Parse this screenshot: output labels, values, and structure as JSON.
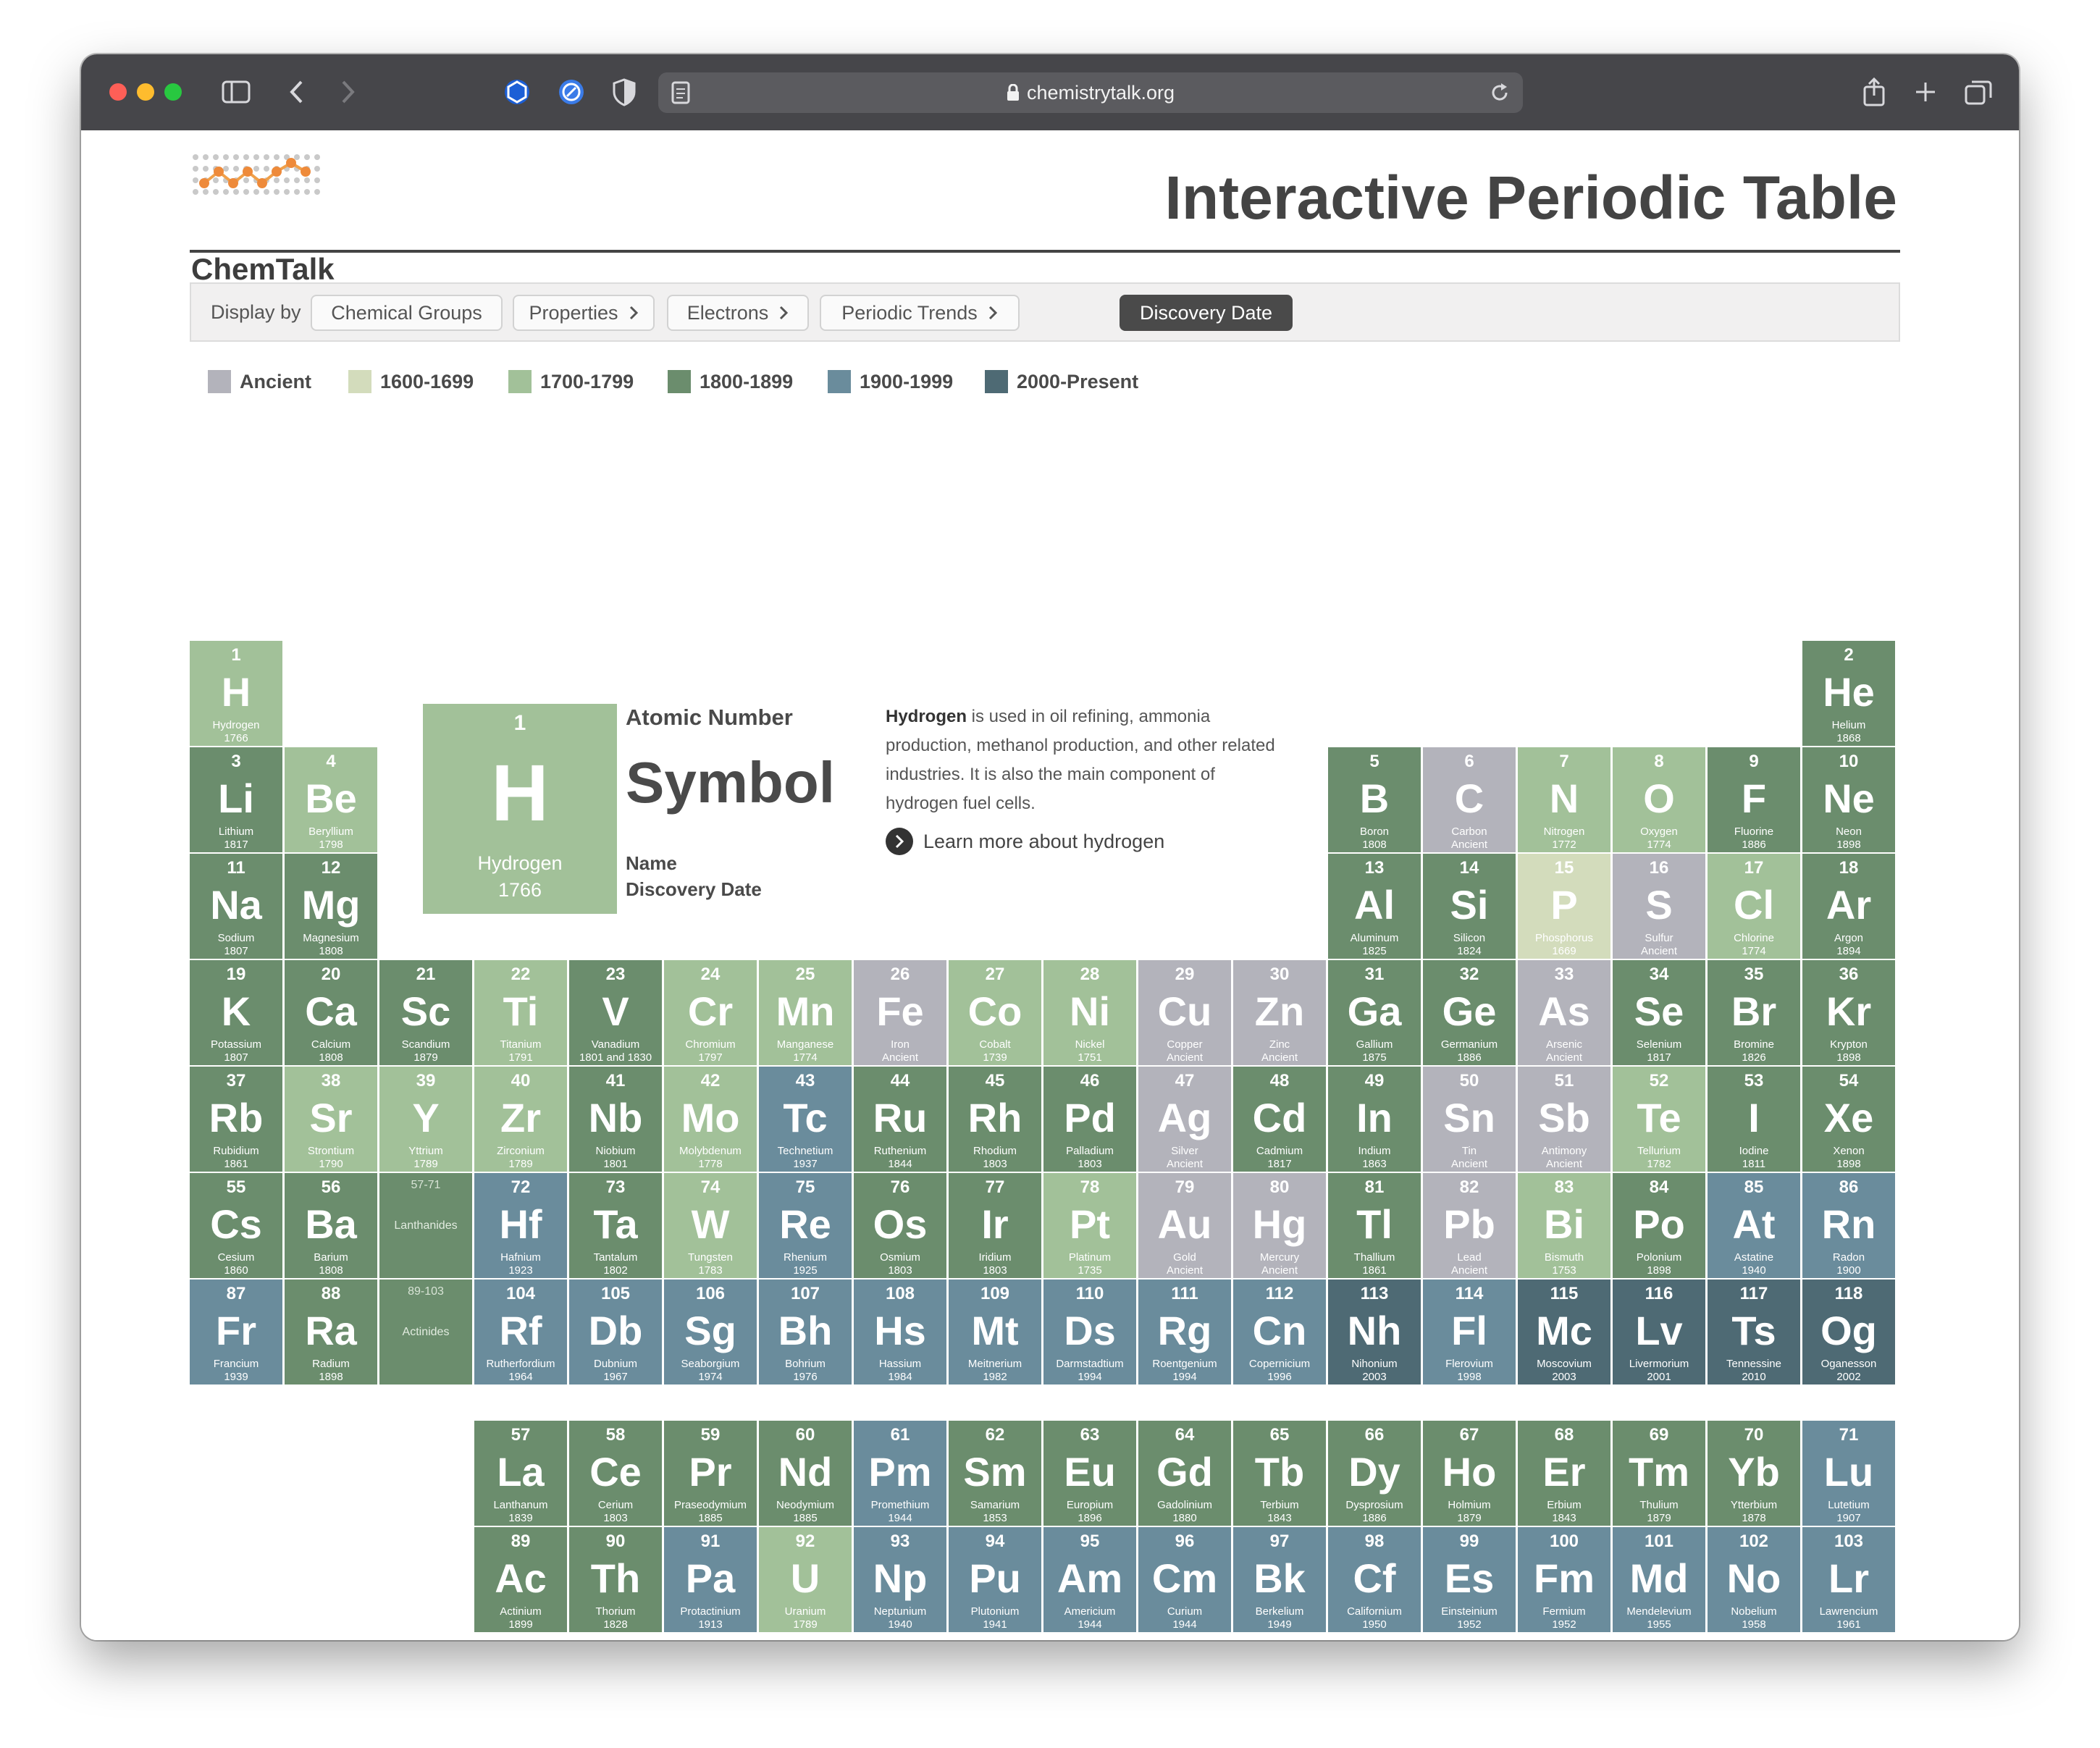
{
  "browser": {
    "url": "chemistrytalk.org"
  },
  "header": {
    "logo_text": "ChemTalk",
    "title": "Interactive Periodic Table"
  },
  "display": {
    "label": "Display by",
    "buttons": [
      {
        "label": "Chemical Groups",
        "chevron": false,
        "active": false
      },
      {
        "label": "Properties",
        "chevron": true,
        "active": false
      },
      {
        "label": "Electrons",
        "chevron": true,
        "active": false
      },
      {
        "label": "Periodic Trends",
        "chevron": true,
        "active": false
      },
      {
        "label": "Discovery Date",
        "chevron": false,
        "active": true
      }
    ]
  },
  "legend": [
    {
      "label": "Ancient",
      "color": "#b3b3bb"
    },
    {
      "label": "1600-1699",
      "color": "#d3dcbc"
    },
    {
      "label": "1700-1799",
      "color": "#a2c199"
    },
    {
      "label": "1800-1899",
      "color": "#6b8d6d"
    },
    {
      "label": "1900-1999",
      "color": "#6a8c9c"
    },
    {
      "label": "2000-Present",
      "color": "#4e6a74"
    }
  ],
  "key": {
    "number": "1",
    "symbol": "H",
    "name": "Hydrogen",
    "date": "1766",
    "label_atomic_number": "Atomic Number",
    "label_symbol": "Symbol",
    "label_name": "Name",
    "label_date": "Discovery Date",
    "desc_element": "Hydrogen",
    "desc_text": " is used in oil refining, ammonia production, methanol production, and other related industries. It is also the main component of hydrogen fuel cells.",
    "learn_more": "Learn more about hydrogen"
  },
  "placeholders": [
    {
      "range": "57-71",
      "label": "Lanthanides"
    },
    {
      "range": "89-103",
      "label": "Actinides"
    }
  ],
  "elements": [
    [
      "1",
      "H",
      "Hydrogen",
      "1766"
    ],
    [
      "2",
      "He",
      "Helium",
      "1868"
    ],
    [
      "3",
      "Li",
      "Lithium",
      "1817"
    ],
    [
      "4",
      "Be",
      "Beryllium",
      "1798"
    ],
    [
      "5",
      "B",
      "Boron",
      "1808"
    ],
    [
      "6",
      "C",
      "Carbon",
      "Ancient"
    ],
    [
      "7",
      "N",
      "Nitrogen",
      "1772"
    ],
    [
      "8",
      "O",
      "Oxygen",
      "1774"
    ],
    [
      "9",
      "F",
      "Fluorine",
      "1886"
    ],
    [
      "10",
      "Ne",
      "Neon",
      "1898"
    ],
    [
      "11",
      "Na",
      "Sodium",
      "1807"
    ],
    [
      "12",
      "Mg",
      "Magnesium",
      "1808"
    ],
    [
      "13",
      "Al",
      "Aluminum",
      "1825"
    ],
    [
      "14",
      "Si",
      "Silicon",
      "1824"
    ],
    [
      "15",
      "P",
      "Phosphorus",
      "1669"
    ],
    [
      "16",
      "S",
      "Sulfur",
      "Ancient"
    ],
    [
      "17",
      "Cl",
      "Chlorine",
      "1774"
    ],
    [
      "18",
      "Ar",
      "Argon",
      "1894"
    ],
    [
      "19",
      "K",
      "Potassium",
      "1807"
    ],
    [
      "20",
      "Ca",
      "Calcium",
      "1808"
    ],
    [
      "21",
      "Sc",
      "Scandium",
      "1879"
    ],
    [
      "22",
      "Ti",
      "Titanium",
      "1791"
    ],
    [
      "23",
      "V",
      "Vanadium",
      "1801 and 1830"
    ],
    [
      "24",
      "Cr",
      "Chromium",
      "1797"
    ],
    [
      "25",
      "Mn",
      "Manganese",
      "1774"
    ],
    [
      "26",
      "Fe",
      "Iron",
      "Ancient"
    ],
    [
      "27",
      "Co",
      "Cobalt",
      "1739"
    ],
    [
      "28",
      "Ni",
      "Nickel",
      "1751"
    ],
    [
      "29",
      "Cu",
      "Copper",
      "Ancient"
    ],
    [
      "30",
      "Zn",
      "Zinc",
      "Ancient"
    ],
    [
      "31",
      "Ga",
      "Gallium",
      "1875"
    ],
    [
      "32",
      "Ge",
      "Germanium",
      "1886"
    ],
    [
      "33",
      "As",
      "Arsenic",
      "Ancient"
    ],
    [
      "34",
      "Se",
      "Selenium",
      "1817"
    ],
    [
      "35",
      "Br",
      "Bromine",
      "1826"
    ],
    [
      "36",
      "Kr",
      "Krypton",
      "1898"
    ],
    [
      "37",
      "Rb",
      "Rubidium",
      "1861"
    ],
    [
      "38",
      "Sr",
      "Strontium",
      "1790"
    ],
    [
      "39",
      "Y",
      "Yttrium",
      "1789"
    ],
    [
      "40",
      "Zr",
      "Zirconium",
      "1789"
    ],
    [
      "41",
      "Nb",
      "Niobium",
      "1801"
    ],
    [
      "42",
      "Mo",
      "Molybdenum",
      "1778"
    ],
    [
      "43",
      "Tc",
      "Technetium",
      "1937"
    ],
    [
      "44",
      "Ru",
      "Ruthenium",
      "1844"
    ],
    [
      "45",
      "Rh",
      "Rhodium",
      "1803"
    ],
    [
      "46",
      "Pd",
      "Palladium",
      "1803"
    ],
    [
      "47",
      "Ag",
      "Silver",
      "Ancient"
    ],
    [
      "48",
      "Cd",
      "Cadmium",
      "1817"
    ],
    [
      "49",
      "In",
      "Indium",
      "1863"
    ],
    [
      "50",
      "Sn",
      "Tin",
      "Ancient"
    ],
    [
      "51",
      "Sb",
      "Antimony",
      "Ancient"
    ],
    [
      "52",
      "Te",
      "Tellurium",
      "1782"
    ],
    [
      "53",
      "I",
      "Iodine",
      "1811"
    ],
    [
      "54",
      "Xe",
      "Xenon",
      "1898"
    ],
    [
      "55",
      "Cs",
      "Cesium",
      "1860"
    ],
    [
      "56",
      "Ba",
      "Barium",
      "1808"
    ],
    [
      "72",
      "Hf",
      "Hafnium",
      "1923"
    ],
    [
      "73",
      "Ta",
      "Tantalum",
      "1802"
    ],
    [
      "74",
      "W",
      "Tungsten",
      "1783"
    ],
    [
      "75",
      "Re",
      "Rhenium",
      "1925"
    ],
    [
      "76",
      "Os",
      "Osmium",
      "1803"
    ],
    [
      "77",
      "Ir",
      "Iridium",
      "1803"
    ],
    [
      "78",
      "Pt",
      "Platinum",
      "1735"
    ],
    [
      "79",
      "Au",
      "Gold",
      "Ancient"
    ],
    [
      "80",
      "Hg",
      "Mercury",
      "Ancient"
    ],
    [
      "81",
      "Tl",
      "Thallium",
      "1861"
    ],
    [
      "82",
      "Pb",
      "Lead",
      "Ancient"
    ],
    [
      "83",
      "Bi",
      "Bismuth",
      "1753"
    ],
    [
      "84",
      "Po",
      "Polonium",
      "1898"
    ],
    [
      "85",
      "At",
      "Astatine",
      "1940"
    ],
    [
      "86",
      "Rn",
      "Radon",
      "1900"
    ],
    [
      "87",
      "Fr",
      "Francium",
      "1939"
    ],
    [
      "88",
      "Ra",
      "Radium",
      "1898"
    ],
    [
      "104",
      "Rf",
      "Rutherfordium",
      "1964"
    ],
    [
      "105",
      "Db",
      "Dubnium",
      "1967"
    ],
    [
      "106",
      "Sg",
      "Seaborgium",
      "1974"
    ],
    [
      "107",
      "Bh",
      "Bohrium",
      "1976"
    ],
    [
      "108",
      "Hs",
      "Hassium",
      "1984"
    ],
    [
      "109",
      "Mt",
      "Meitnerium",
      "1982"
    ],
    [
      "110",
      "Ds",
      "Darmstadtium",
      "1994"
    ],
    [
      "111",
      "Rg",
      "Roentgenium",
      "1994"
    ],
    [
      "112",
      "Cn",
      "Copernicium",
      "1996"
    ],
    [
      "113",
      "Nh",
      "Nihonium",
      "2003"
    ],
    [
      "114",
      "Fl",
      "Flerovium",
      "1998"
    ],
    [
      "115",
      "Mc",
      "Moscovium",
      "2003"
    ],
    [
      "116",
      "Lv",
      "Livermorium",
      "2001"
    ],
    [
      "117",
      "Ts",
      "Tennessine",
      "2010"
    ],
    [
      "118",
      "Og",
      "Oganesson",
      "2002"
    ],
    [
      "57",
      "La",
      "Lanthanum",
      "1839"
    ],
    [
      "58",
      "Ce",
      "Cerium",
      "1803"
    ],
    [
      "59",
      "Pr",
      "Praseodymium",
      "1885"
    ],
    [
      "60",
      "Nd",
      "Neodymium",
      "1885"
    ],
    [
      "61",
      "Pm",
      "Promethium",
      "1944"
    ],
    [
      "62",
      "Sm",
      "Samarium",
      "1853"
    ],
    [
      "63",
      "Eu",
      "Europium",
      "1896"
    ],
    [
      "64",
      "Gd",
      "Gadolinium",
      "1880"
    ],
    [
      "65",
      "Tb",
      "Terbium",
      "1843"
    ],
    [
      "66",
      "Dy",
      "Dysprosium",
      "1886"
    ],
    [
      "67",
      "Ho",
      "Holmium",
      "1879"
    ],
    [
      "68",
      "Er",
      "Erbium",
      "1843"
    ],
    [
      "69",
      "Tm",
      "Thulium",
      "1879"
    ],
    [
      "70",
      "Yb",
      "Ytterbium",
      "1878"
    ],
    [
      "71",
      "Lu",
      "Lutetium",
      "1907"
    ],
    [
      "89",
      "Ac",
      "Actinium",
      "1899"
    ],
    [
      "90",
      "Th",
      "Thorium",
      "1828"
    ],
    [
      "91",
      "Pa",
      "Protactinium",
      "1913"
    ],
    [
      "92",
      "U",
      "Uranium",
      "1789"
    ],
    [
      "93",
      "Np",
      "Neptunium",
      "1940"
    ],
    [
      "94",
      "Pu",
      "Plutonium",
      "1941"
    ],
    [
      "95",
      "Am",
      "Americium",
      "1944"
    ],
    [
      "96",
      "Cm",
      "Curium",
      "1944"
    ],
    [
      "97",
      "Bk",
      "Berkelium",
      "1949"
    ],
    [
      "98",
      "Cf",
      "Californium",
      "1950"
    ],
    [
      "99",
      "Es",
      "Einsteinium",
      "1952"
    ],
    [
      "100",
      "Fm",
      "Fermium",
      "1952"
    ],
    [
      "101",
      "Md",
      "Mendelevium",
      "1955"
    ],
    [
      "102",
      "No",
      "Nobelium",
      "1958"
    ],
    [
      "103",
      "Lr",
      "Lawrencium",
      "1961"
    ]
  ]
}
